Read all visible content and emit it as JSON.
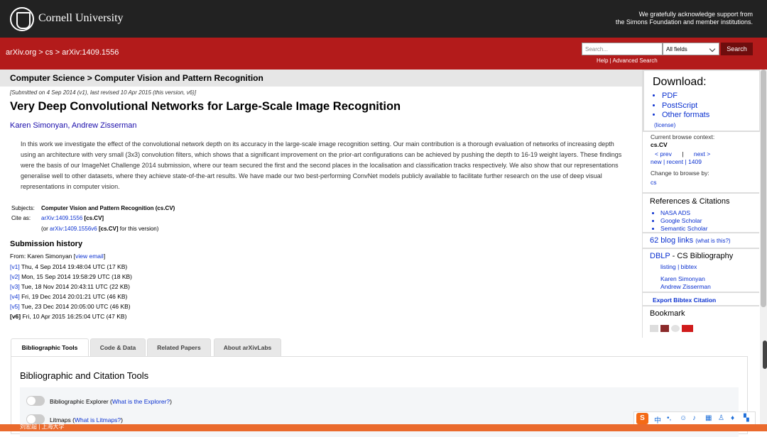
{
  "header": {
    "university": "Cornell University",
    "ack_line1": "We gratefully acknowledge support from",
    "ack_line2": "the Simons Foundation and member institutions."
  },
  "nav": {
    "crumbs": "arXiv.org > cs > arXiv:1409.1556",
    "search_placeholder": "Search...",
    "search_field": "All fields",
    "search_button": "Search",
    "help": "Help | Advanced Search"
  },
  "paper": {
    "category": "Computer Science > Computer Vision and Pattern Recognition",
    "submitted": "[Submitted on 4 Sep 2014 (v1), last revised 10 Apr 2015 (this version, v6)]",
    "title": "Very Deep Convolutional Networks for Large-Scale Image Recognition",
    "authors": "Karen Simonyan, Andrew Zisserman",
    "abstract": "In this work we investigate the effect of the convolutional network depth on its accuracy in the large-scale image recognition setting. Our main contribution is a thorough evaluation of networks of increasing depth using an architecture with very small (3x3) convolution filters, which shows that a significant improvement on the prior-art configurations can be achieved by pushing the depth to 16-19 weight layers. These findings were the basis of our ImageNet Challenge 2014 submission, where our team secured the first and the second places in the localisation and classification tracks respectively. We also show that our representations generalise well to other datasets, where they achieve state-of-the-art results. We have made our two best-performing ConvNet models publicly available to facilitate further research on the use of deep visual representations in computer vision.",
    "subjects_label": "Subjects:",
    "subjects": "Computer Vision and Pattern Recognition (cs.CV)",
    "cite_label": "Cite as:",
    "cite_id": "arXiv:1409.1556",
    "cite_cat": "[cs.CV]",
    "cite_v6_pre": "(or ",
    "cite_v6_id": "arXiv:1409.1556v6",
    "cite_v6_cat": "[cs.CV]",
    "cite_v6_post": " for this version)"
  },
  "history": {
    "title": "Submission history",
    "from_prefix": "From: Karen Simonyan [",
    "from_link": "view email",
    "from_suffix": "]",
    "versions": [
      {
        "v": "[v1]",
        "text": " Thu, 4 Sep 2014 19:48:04 UTC (17 KB)"
      },
      {
        "v": "[v2]",
        "text": " Mon, 15 Sep 2014 19:58:29 UTC (18 KB)"
      },
      {
        "v": "[v3]",
        "text": " Tue, 18 Nov 2014 20:43:11 UTC (22 KB)"
      },
      {
        "v": "[v4]",
        "text": " Fri, 19 Dec 2014 20:01:21 UTC (46 KB)"
      },
      {
        "v": "[v5]",
        "text": " Tue, 23 Dec 2014 20:05:00 UTC (46 KB)"
      },
      {
        "v": "[v6]",
        "text": " Fri, 10 Apr 2015 16:25:04 UTC (47 KB)"
      }
    ]
  },
  "tabs": [
    "Bibliographic Tools",
    "Code & Data",
    "Related Papers",
    "About arXivLabs"
  ],
  "biblio": {
    "title": "Bibliographic and Citation Tools",
    "explorer_label": "Bibliographic Explorer (",
    "explorer_link": "What is the Explorer?",
    "explorer_close": ")",
    "litmaps_label": "Litmaps (",
    "litmaps_link": "What is Litmaps?",
    "litmaps_close": ")"
  },
  "sidebar": {
    "download_title": "Download:",
    "download_items": [
      "PDF",
      "PostScript",
      "Other formats"
    ],
    "license": "(license)",
    "ctx_label": "Current browse context:",
    "ctx_value": "cs.CV",
    "prev": "< prev",
    "sep": "|",
    "next": "next >",
    "new_recent": "new | recent | 1409",
    "change_label": "Change to browse by:",
    "change_value": "cs",
    "refs_title": "References & Citations",
    "refs_items": [
      "NASA ADS",
      "Google Scholar",
      "Semantic Scholar"
    ],
    "blog_links": "62 blog links",
    "blog_what": "(what is this?)",
    "dblp": "DBLP",
    "dblp_rest": " - CS Bibliography",
    "listing": "listing | bibtex",
    "author1": "Karen Simonyan",
    "author2": "Andrew Zisserman",
    "export": "Export Bibtex Citation",
    "bookmark": "Bookmark"
  },
  "footer": {
    "text": "刘宏超 | 上海大学"
  },
  "ime": {
    "lang": "中"
  },
  "colors": {
    "topbar": "#222222",
    "redbar": "#b31b1b",
    "link": "#1a0dab",
    "bottom": "#ea6a2d"
  }
}
